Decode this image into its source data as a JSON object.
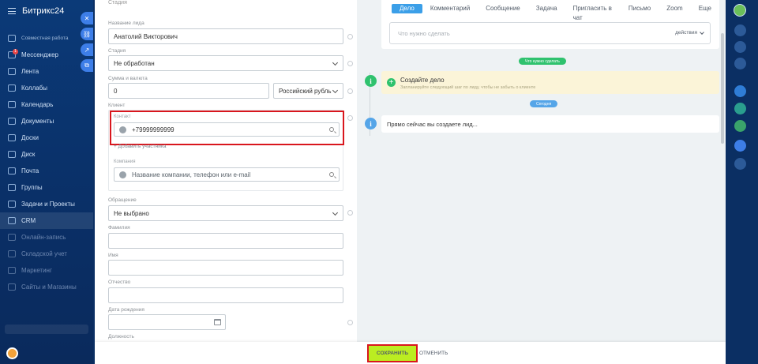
{
  "app": {
    "brand": "Битрикс24"
  },
  "sidebar": {
    "items": [
      {
        "label": "Совместная работа",
        "small": true
      },
      {
        "label": "Мессенджер",
        "badge": "1"
      },
      {
        "label": "Лента"
      },
      {
        "label": "Коллабы"
      },
      {
        "label": "Календарь"
      },
      {
        "label": "Документы"
      },
      {
        "label": "Доски"
      },
      {
        "label": "Диск"
      },
      {
        "label": "Почта"
      },
      {
        "label": "Группы"
      },
      {
        "label": "Задачи и Проекты"
      },
      {
        "label": "CRM",
        "active": true
      },
      {
        "label": "Онлайн-запись"
      },
      {
        "label": "Складской учет"
      },
      {
        "label": "Маркетинг"
      },
      {
        "label": "Сайты и Магазины"
      }
    ]
  },
  "form": {
    "header": "Стадия",
    "lead_name_label": "Название лида",
    "lead_name_value": "Анатолий Викторович",
    "stage_label": "Стадия",
    "stage_value": "Не обработан",
    "amount_label": "Сумма и валюта",
    "amount_value": "0",
    "currency_value": "Российский рубль",
    "client_label": "Клиент",
    "contact_label": "Контакт",
    "contact_value": "+79999999999",
    "add_participant": "+ Добавить участника",
    "company_label": "Компания",
    "company_placeholder": "Название компании, телефон или e-mail",
    "salutation_label": "Обращение",
    "salutation_value": "Не выбрано",
    "lastname_label": "Фамилия",
    "firstname_label": "Имя",
    "middlename_label": "Отчество",
    "birthdate_label": "Дата рождения",
    "position_label": "Должность"
  },
  "buttons": {
    "save": "СОХРАНИТЬ",
    "cancel": "ОТМЕНИТЬ"
  },
  "timeline": {
    "tabs": [
      "Дело",
      "Комментарий",
      "Сообщение",
      "Задача",
      "Пригласить в чат",
      "Письмо",
      "Zoom",
      "Еще"
    ],
    "todo_placeholder": "Что нужно сделать",
    "actions_label": "действия",
    "todo_pill": "Что нужно сделать",
    "create_title": "Создайте дело",
    "create_hint": "Запланируйте следующий шаг по лиду, чтобы не забыть о клиенте",
    "today_pill": "Сегодня",
    "now_text": "Прямо сейчас вы создаете лид..."
  },
  "colors": {
    "save_button": "#bbed21",
    "highlight_frame": "#d9161d",
    "accent_blue": "#3b9fe8",
    "accent_green": "#2fc26e"
  }
}
